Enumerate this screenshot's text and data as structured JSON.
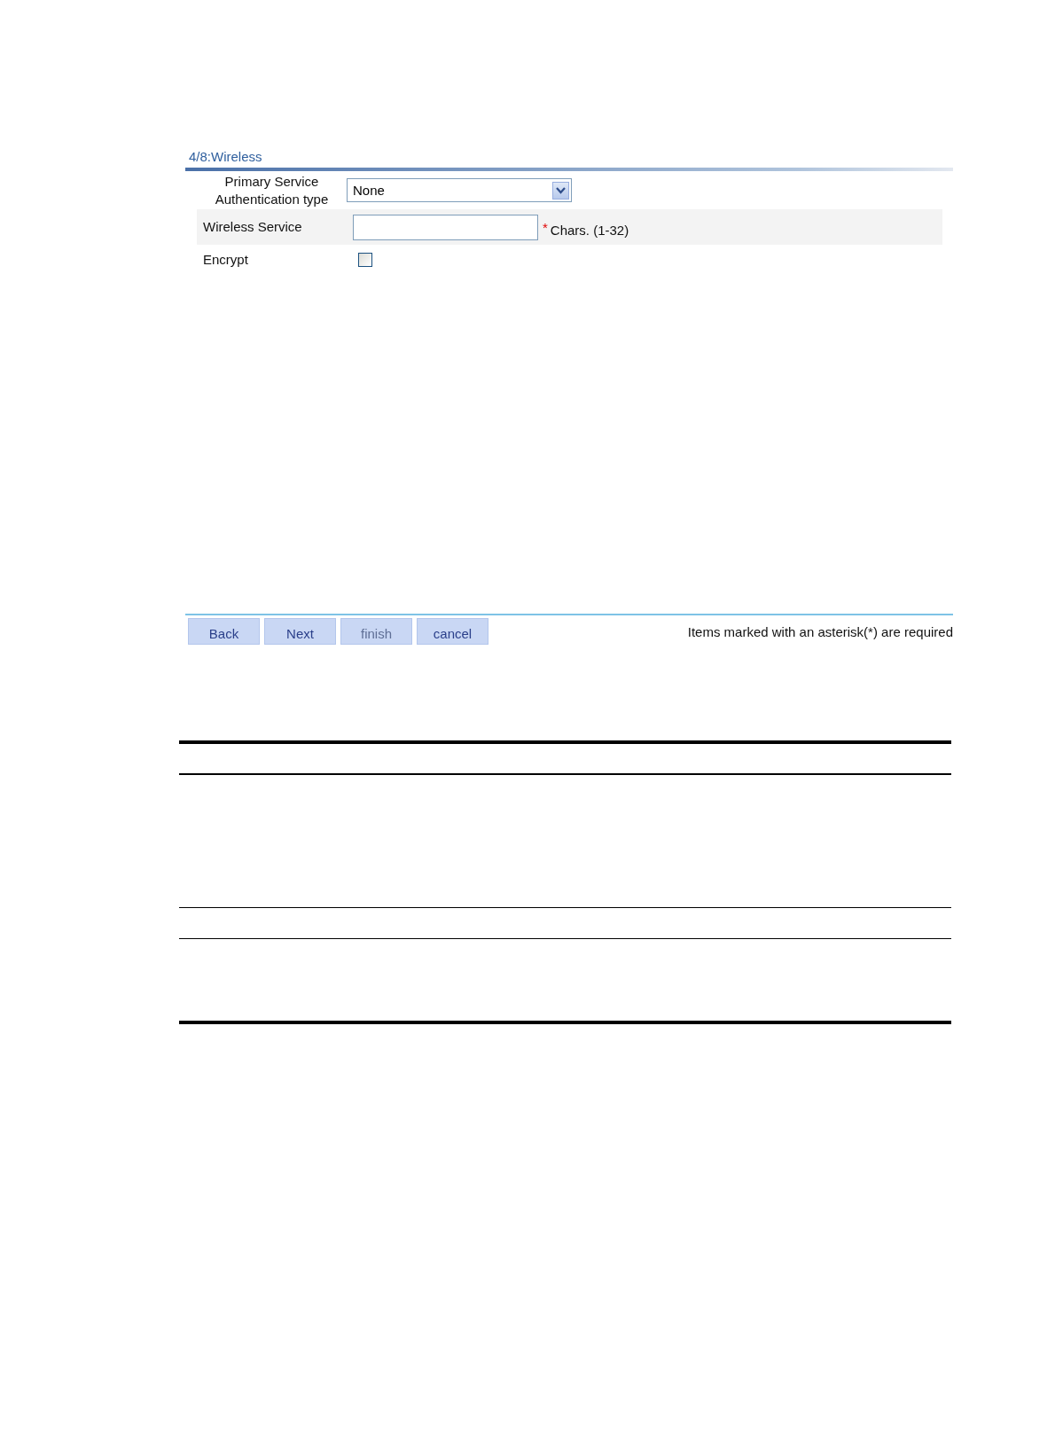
{
  "wizard": {
    "title": "4/8:Wireless",
    "fields": [
      {
        "kind": "select",
        "label": "Primary Service Authentication type",
        "value": "None",
        "shaded": false
      },
      {
        "kind": "text",
        "label": "Wireless Service",
        "required_mark": "*",
        "hint": "Chars. (1-32)",
        "shaded": true
      },
      {
        "kind": "checkbox",
        "label": "Encrypt",
        "checked": false,
        "shaded": false
      }
    ],
    "buttons": [
      {
        "label": "Back",
        "disabled": false
      },
      {
        "label": "Next",
        "disabled": false
      },
      {
        "label": "finish",
        "disabled": true
      },
      {
        "label": "cancel",
        "disabled": false
      }
    ],
    "footnote": "Items marked with an asterisk(*) are required"
  }
}
